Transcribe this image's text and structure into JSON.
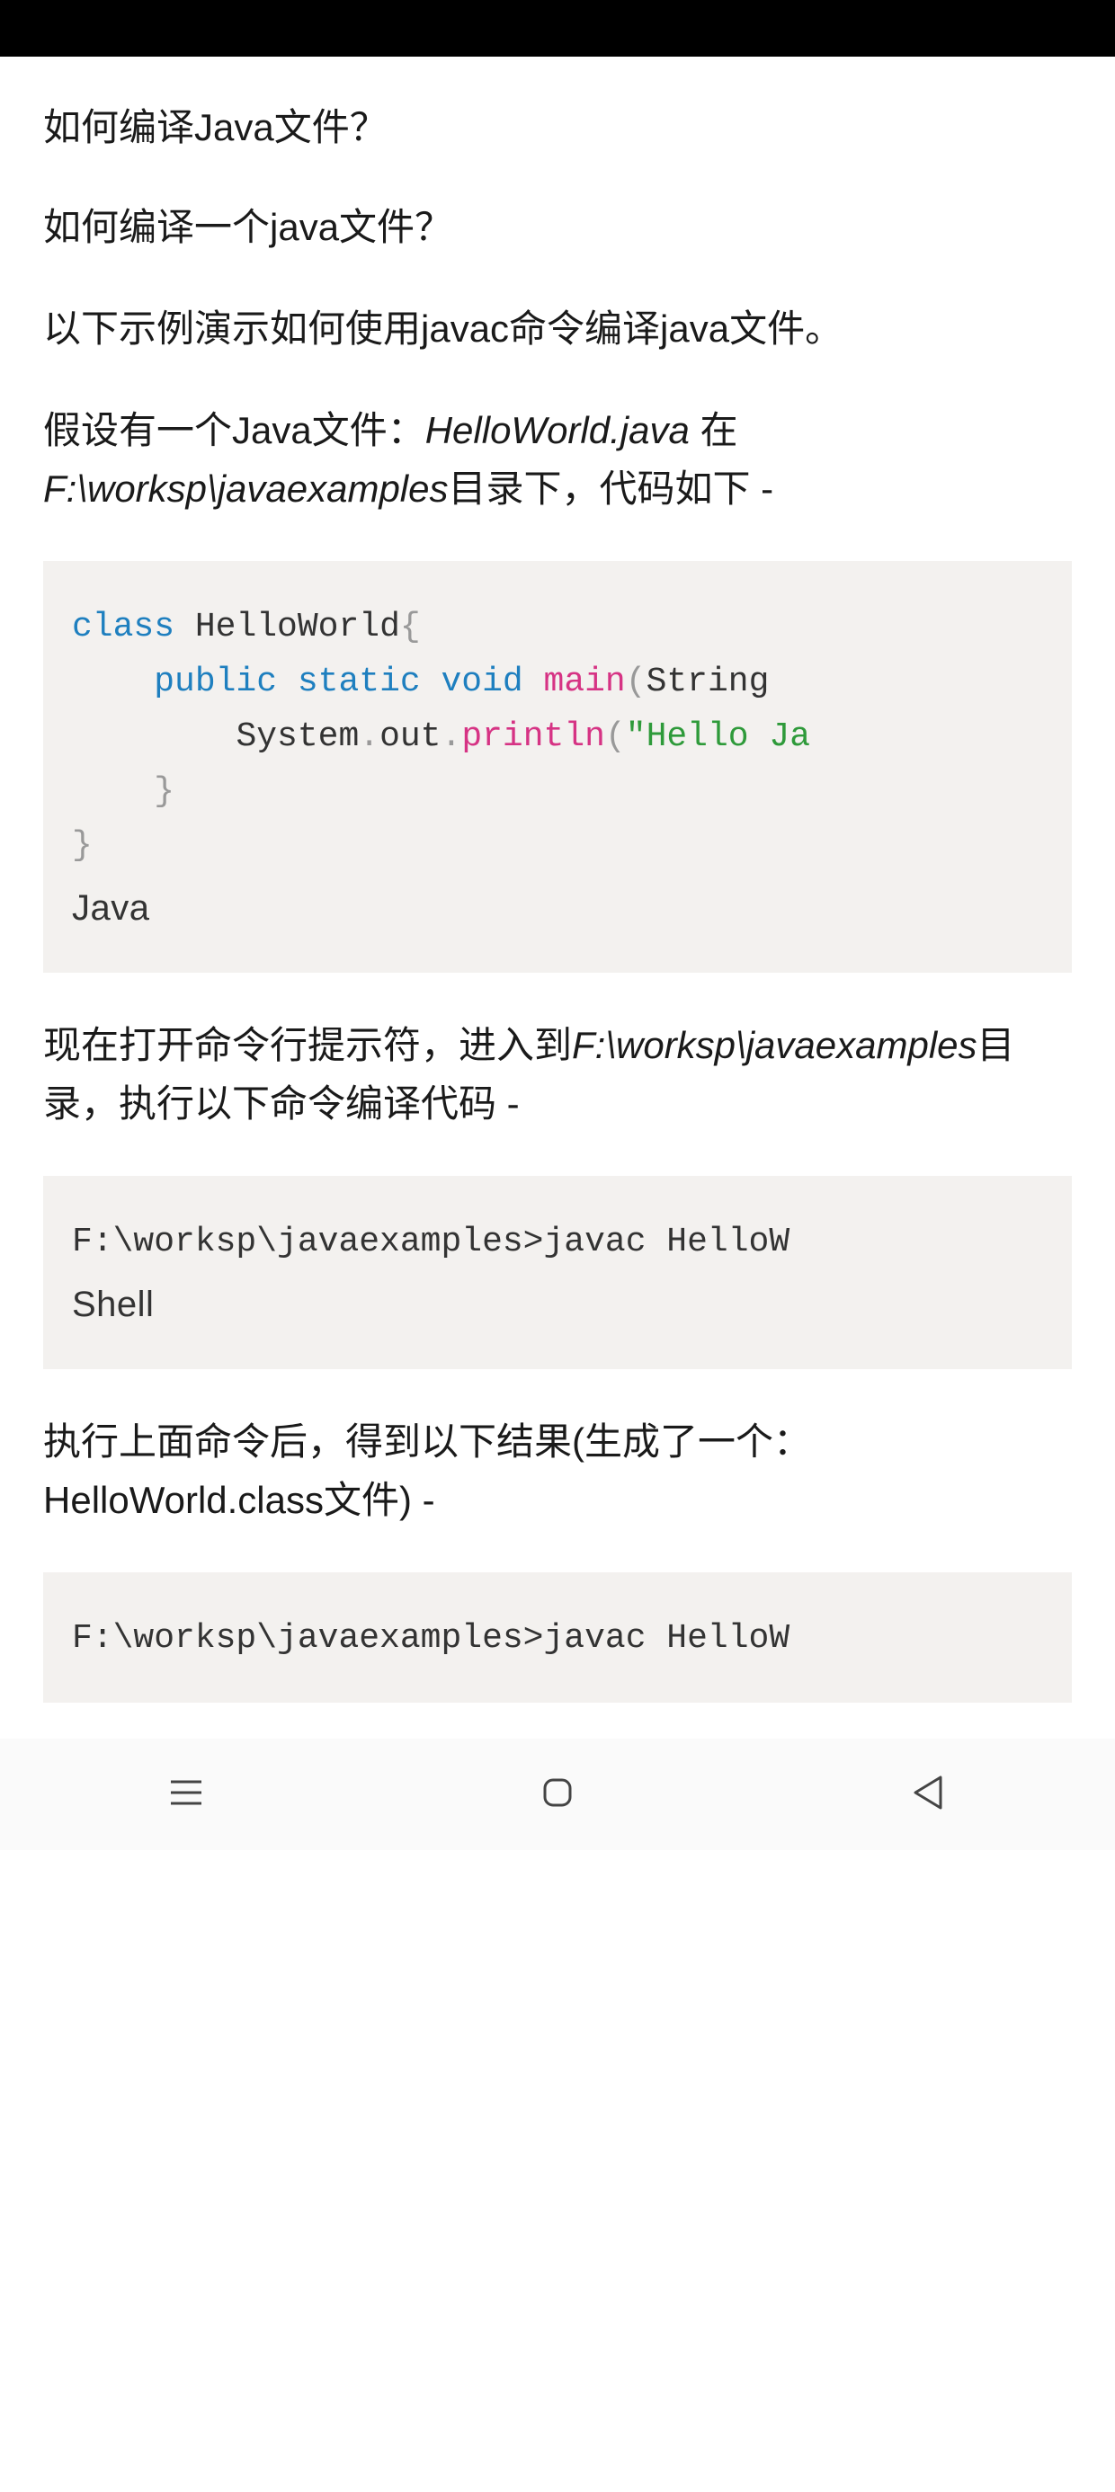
{
  "article": {
    "title": "如何编译Java文件？",
    "p1": "如何编译一个java文件？",
    "p2": "以下示例演示如何使用javac命令编译java文件。",
    "p3_pre": "假设有一个Java文件：",
    "p3_file": "HelloWorld.java",
    "p3_mid": " 在",
    "p3_path": "F:\\worksp\\javaexamples",
    "p3_post": "目录下，代码如下 -",
    "p4_pre": "现在打开命令行提示符，进入到",
    "p4_path": "F:\\worksp\\javaexamples",
    "p4_post": "目录，执行以下命令编译代码 -",
    "p5": "执行上面命令后，得到以下结果(生成了一个：HelloWorld.class文件) -"
  },
  "code1": {
    "lang": "Java",
    "tok": {
      "class": "class",
      "HelloWorld": " HelloWorld",
      "ob1": "{",
      "indent1": "    ",
      "public": "public",
      "static": " static",
      "void": " void",
      "main": " main",
      "op": "(",
      "String": "String ",
      "indent2": "        ",
      "System": "System",
      "dot1": ".",
      "out": "out",
      "dot2": ".",
      "println": "println",
      "op2": "(",
      "str": "\"Hello Ja",
      "indent_cb1": "    ",
      "cb1": "}",
      "cb2": "}"
    }
  },
  "code2": {
    "lang": "Shell",
    "line": "F:\\worksp\\javaexamples>javac HelloW"
  },
  "code3": {
    "line": "F:\\worksp\\javaexamples>javac HelloW"
  }
}
